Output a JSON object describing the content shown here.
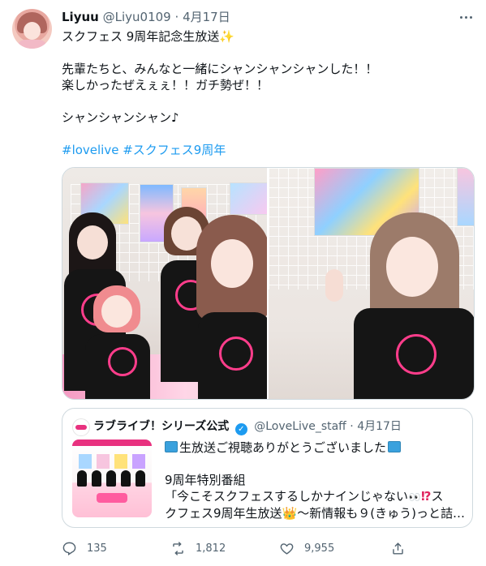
{
  "tweet": {
    "author_name": "Liyuu",
    "author_handle": "@Liyu0109",
    "dot": "·",
    "date": "4月17日",
    "lines": [
      "スクフェス 9周年記念生放送",
      "",
      "先輩たちと、みんなと一緒にシャンシャンシャンした！！",
      "楽しかったぜえぇぇ！！ガチ勢ぜ！！",
      "",
      "シャンシャンシャン♪",
      ""
    ],
    "sparkle": "✨",
    "hashtags": "#lovelive #スクフェス9周年"
  },
  "quote": {
    "name": "ラブライブ！シリーズ公式",
    "handle": "@LoveLive_staff",
    "dot": "·",
    "date": "4月17日",
    "line1": "生放送ご視聴ありがとうございました",
    "line3": "9周年特別番組",
    "line4_a": "「今こそスクフェスするしかナインじゃない",
    "line4_b": "ス",
    "line5_a": "クフェス9周年生放送",
    "line5_b": "〜新情報も９(きゅう)っと詰…",
    "eyes": "👀",
    "exq": "⁉",
    "crown": "👑"
  },
  "actions": {
    "reply_count": "135",
    "retweet_count": "1,812",
    "like_count": "9,955"
  },
  "icons": {
    "more": "more-icon",
    "reply": "reply-icon",
    "retweet": "retweet-icon",
    "like": "like-icon",
    "share": "share-icon",
    "verified": "verified-icon",
    "tv": "tv-icon"
  },
  "colors": {
    "link": "#1d9bf0",
    "muted": "#536471",
    "border": "#cfd9de",
    "verified": "#1d9bf0"
  }
}
